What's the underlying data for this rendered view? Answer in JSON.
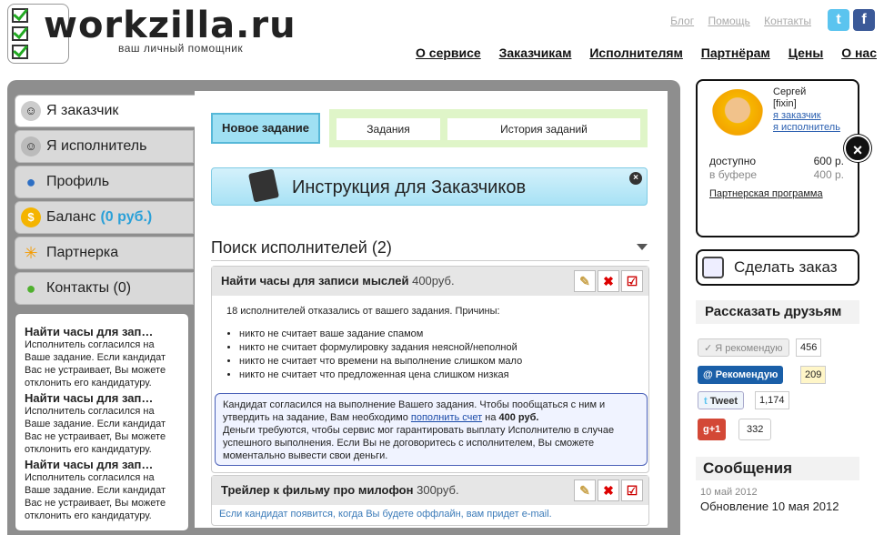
{
  "header": {
    "logo_main": "workzilla",
    "logo_ru": ".ru",
    "tagline": "ваш личный помощник",
    "top_links": [
      "Блог",
      "Помощь",
      "Контакты"
    ],
    "nav": [
      "О сервисе",
      "Заказчикам",
      "Исполнителям",
      "Партнёрам",
      "Цены",
      "О нас"
    ]
  },
  "sidebar": {
    "items": [
      {
        "label": "Я заказчик"
      },
      {
        "label": "Я исполнитель"
      },
      {
        "label": "Профиль"
      },
      {
        "label": "Баланс",
        "extra": "(0 руб.)"
      },
      {
        "label": "Партнерка"
      },
      {
        "label": "Контакты (0)"
      }
    ],
    "notices": [
      {
        "title": "Найти часы для зап…",
        "body": "Исполнитель согласился на Ваше задание. Если кандидат Вас не устраивает, Вы можете отклонить его кандидатуру."
      },
      {
        "title": "Найти часы для зап…",
        "body": "Исполнитель согласился на Ваше задание. Если кандидат Вас не устраивает, Вы можете отклонить его кандидатуру."
      },
      {
        "title": "Найти часы для зап…",
        "body": "Исполнитель согласился на Ваше задание. Если кандидат Вас не устраивает, Вы можете отклонить его кандидатуру."
      }
    ]
  },
  "main": {
    "new_task_button": "Новое задание",
    "tabs": [
      "Задания",
      "История заданий"
    ],
    "instructions_banner": "Инструкция для Заказчиков",
    "section_title": "Поиск исполнителей (2)",
    "task1": {
      "title": "Найти часы для записи мыслей",
      "price": "400руб.",
      "intro": "18 исполнителей отказались от вашего задания. Причины:",
      "reasons": [
        "никто не считает ваше задание спамом",
        "никто не считает формулировку задания неясной/неполной",
        "никто не считает что времени на выполнение слишком мало",
        "никто не считает что предложенная цена слишком низкая"
      ],
      "info_line1": "Кандидат согласился на выполнение Вашего задания. Чтобы пообщаться с ним и",
      "info_line2_pre": "утвердить на задание, Вам необходимо ",
      "info_link": "пополнить счет",
      "info_line2_post": " на ",
      "info_amount": "400 руб.",
      "info_line3": "Деньги требуются, чтобы сервис мог гарантировать выплату Исполнителю в случае",
      "info_line4": "успешного выполнения. Если Вы не договоритесь с исполнителем, Вы сможете",
      "info_line5": "моментально вывести свои деньги."
    },
    "task2": {
      "title": "Трейлер к фильму про милофон",
      "price": "300руб.",
      "note": "Если кандидат появится, когда Вы будете оффлайн, вам придет e-mail."
    }
  },
  "profile": {
    "name": "Сергей",
    "login": "[fixin]",
    "link_customer": "я заказчик",
    "link_executor": "я исполнитель",
    "available_label": "доступно",
    "available_value": "600 р.",
    "buffer_label": "в буфере",
    "buffer_value": "400 р.",
    "partner_link": "Партнерская программа"
  },
  "order_button": "Сделать заказ",
  "share": {
    "title": "Рассказать друзьям",
    "recommend_label": "Я рекомендую",
    "recommend_count": "456",
    "mail_label": "Рекомендую",
    "mail_count": "209",
    "tweet_label": "Tweet",
    "tweet_count": "1,174",
    "gplus_label": "+1",
    "gplus_count": "332"
  },
  "messages": {
    "title": "Сообщения",
    "date": "10 май 2012",
    "text": "Обновление 10 мая 2012"
  },
  "colors": {
    "accent_blue": "#9fe0f3",
    "tabs_green": "#dff5c8",
    "link_blue": "#2a5fb0"
  }
}
